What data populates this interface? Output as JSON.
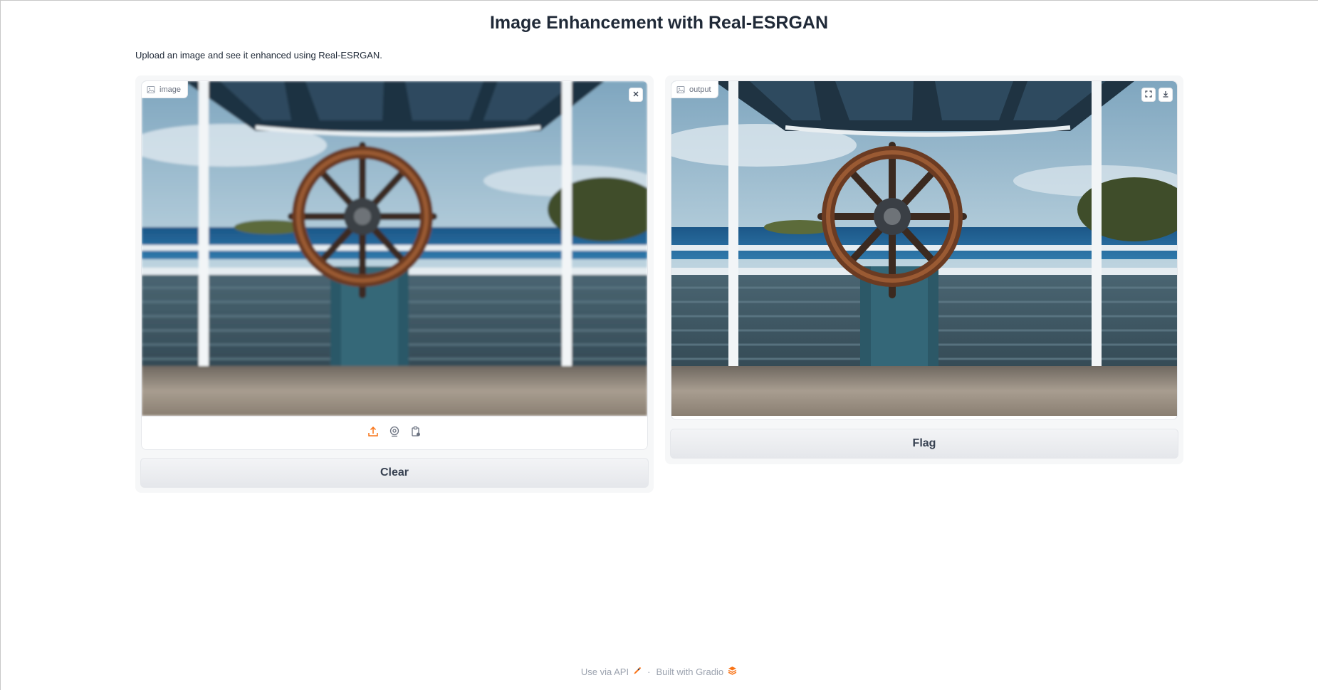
{
  "header": {
    "title": "Image Enhancement with Real-ESRGAN",
    "description": "Upload an image and see it enhanced using Real-ESRGAN."
  },
  "input_panel": {
    "label": "image",
    "label_icon": "image-icon",
    "clear_image_icon": "close-icon",
    "sources": [
      {
        "name": "upload",
        "icon": "upload-icon",
        "color": "#f97316"
      },
      {
        "name": "webcam",
        "icon": "webcam-icon",
        "color": "#6b7280"
      },
      {
        "name": "clipboard",
        "icon": "clipboard-icon",
        "color": "#6b7280"
      }
    ],
    "clear_button": "Clear"
  },
  "output_panel": {
    "label": "output",
    "label_icon": "image-icon",
    "corner_icons": [
      "fullscreen-icon",
      "download-icon"
    ],
    "flag_button": "Flag"
  },
  "footer": {
    "api_link": "Use via API",
    "api_icon": "rocket-icon",
    "separator": "·",
    "gradio_link": "Built with Gradio",
    "gradio_icon": "gradio-logo-icon"
  },
  "colors": {
    "accent": "#f97316",
    "panel_bg": "#f6f7f8",
    "button_bg": "#e5e7eb",
    "text": "#1f2937"
  }
}
